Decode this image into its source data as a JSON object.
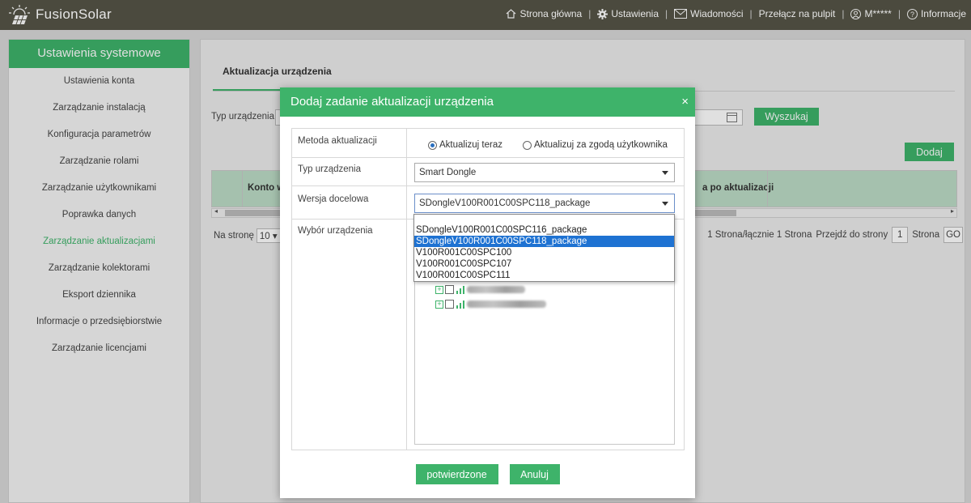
{
  "header": {
    "app_name": "FusionSolar",
    "nav": [
      {
        "label": "Strona główna",
        "icon": "home-icon"
      },
      {
        "label": "Ustawienia",
        "icon": "gear-icon"
      },
      {
        "label": "Wiadomości",
        "icon": "mail-icon"
      },
      {
        "label": "Przełącz na pulpit",
        "icon": ""
      },
      {
        "label": "M*****",
        "icon": "user-icon"
      },
      {
        "label": "Informacje",
        "icon": "help-icon"
      }
    ]
  },
  "sidebar": {
    "title": "Ustawienia systemowe",
    "items": [
      {
        "label": "Ustawienia konta"
      },
      {
        "label": "Zarządzanie instalacją"
      },
      {
        "label": "Konfiguracja parametrów"
      },
      {
        "label": "Zarządzanie rolami"
      },
      {
        "label": "Zarządzanie użytkownikami"
      },
      {
        "label": "Poprawka danych"
      },
      {
        "label": "Zarządzanie aktualizacjami",
        "active": true
      },
      {
        "label": "Zarządzanie kolektorami"
      },
      {
        "label": "Eksport dziennika"
      },
      {
        "label": "Informacje o przedsiębiorstwie"
      },
      {
        "label": "Zarządzanie licencjami"
      }
    ]
  },
  "main": {
    "tab": "Aktualizacja urządzenia",
    "filter_label": "Typ urządzenia",
    "search_button": "Wyszukaj",
    "add_button": "Dodaj",
    "table": {
      "col_konto": "Konto w",
      "col_after": "a po aktualizacji"
    },
    "pager": {
      "per_page_label": "Na stronę",
      "per_page_value": "10",
      "summary": "1 Strona/łącznie 1 Strona",
      "goto_label": "Przejdź do strony",
      "page_value": "1",
      "page_suffix": "Strona",
      "go_button": "GO"
    }
  },
  "modal": {
    "title": "Dodaj zadanie aktualizacji urządzenia",
    "close": "×",
    "fields": {
      "method_label": "Metoda aktualizacji",
      "method_options": [
        "Aktualizuj teraz",
        "Aktualizuj za zgodą użytkownika"
      ],
      "method_selected": 0,
      "device_type_label": "Typ urządzenia",
      "device_type_value": "Smart Dongle",
      "target_version_label": "Wersja docelowa",
      "target_version_value": "SDongleV100R001C00SPC118_package",
      "device_select_label": "Wybór urządzenia"
    },
    "dropdown_options": [
      "SDongleV100R001C00SPC116_package",
      "SDongleV100R001C00SPC118_package",
      "V100R001C00SPC100",
      "V100R001C00SPC107",
      "V100R001C00SPC111"
    ],
    "dropdown_selected": 1,
    "confirm_button": "potwierdzone",
    "cancel_button": "Anuluj"
  },
  "colors": {
    "accent": "#3eb36a",
    "header_bg": "#4b4a3e",
    "selection": "#1e72d2"
  }
}
